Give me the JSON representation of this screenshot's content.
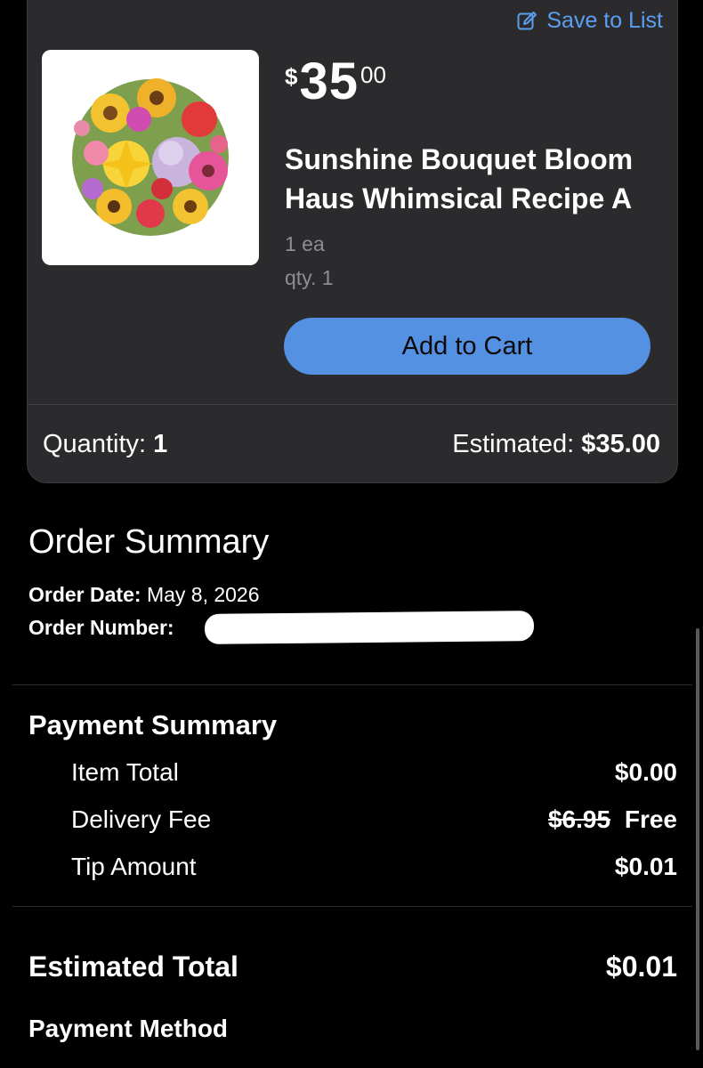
{
  "product_card": {
    "save_link": "Save to List",
    "price": {
      "currency": "$",
      "dollars": "35",
      "cents": "00"
    },
    "title": "Sunshine Bouquet Bloom Haus Whimsical Recipe A",
    "unit": "1 ea",
    "qty": "qty. 1",
    "add_to_cart": "Add to Cart",
    "quantity_label": "Quantity:",
    "quantity_value": "1",
    "estimated_label": "Estimated:",
    "estimated_value": "$35.00",
    "thumbnail_icon": "flower-bouquet-image"
  },
  "order_summary": {
    "heading": "Order Summary",
    "order_date_label": "Order Date:",
    "order_date_value": "May 8, 2026",
    "order_number_label": "Order Number:"
  },
  "payment_summary": {
    "heading": "Payment Summary",
    "rows": [
      {
        "label": "Item Total",
        "value": "$0.00"
      },
      {
        "label": "Delivery Fee",
        "original": "$6.95",
        "value": "Free"
      },
      {
        "label": "Tip Amount",
        "value": "$0.01"
      }
    ],
    "estimated_total_label": "Estimated Total",
    "estimated_total_value": "$0.01",
    "payment_method_label": "Payment Method"
  },
  "colors": {
    "background": "#000000",
    "card": "#2b2b2e",
    "accent_link": "#5b9ff0",
    "button": "#5591e3",
    "muted_text": "#8d8d92"
  }
}
